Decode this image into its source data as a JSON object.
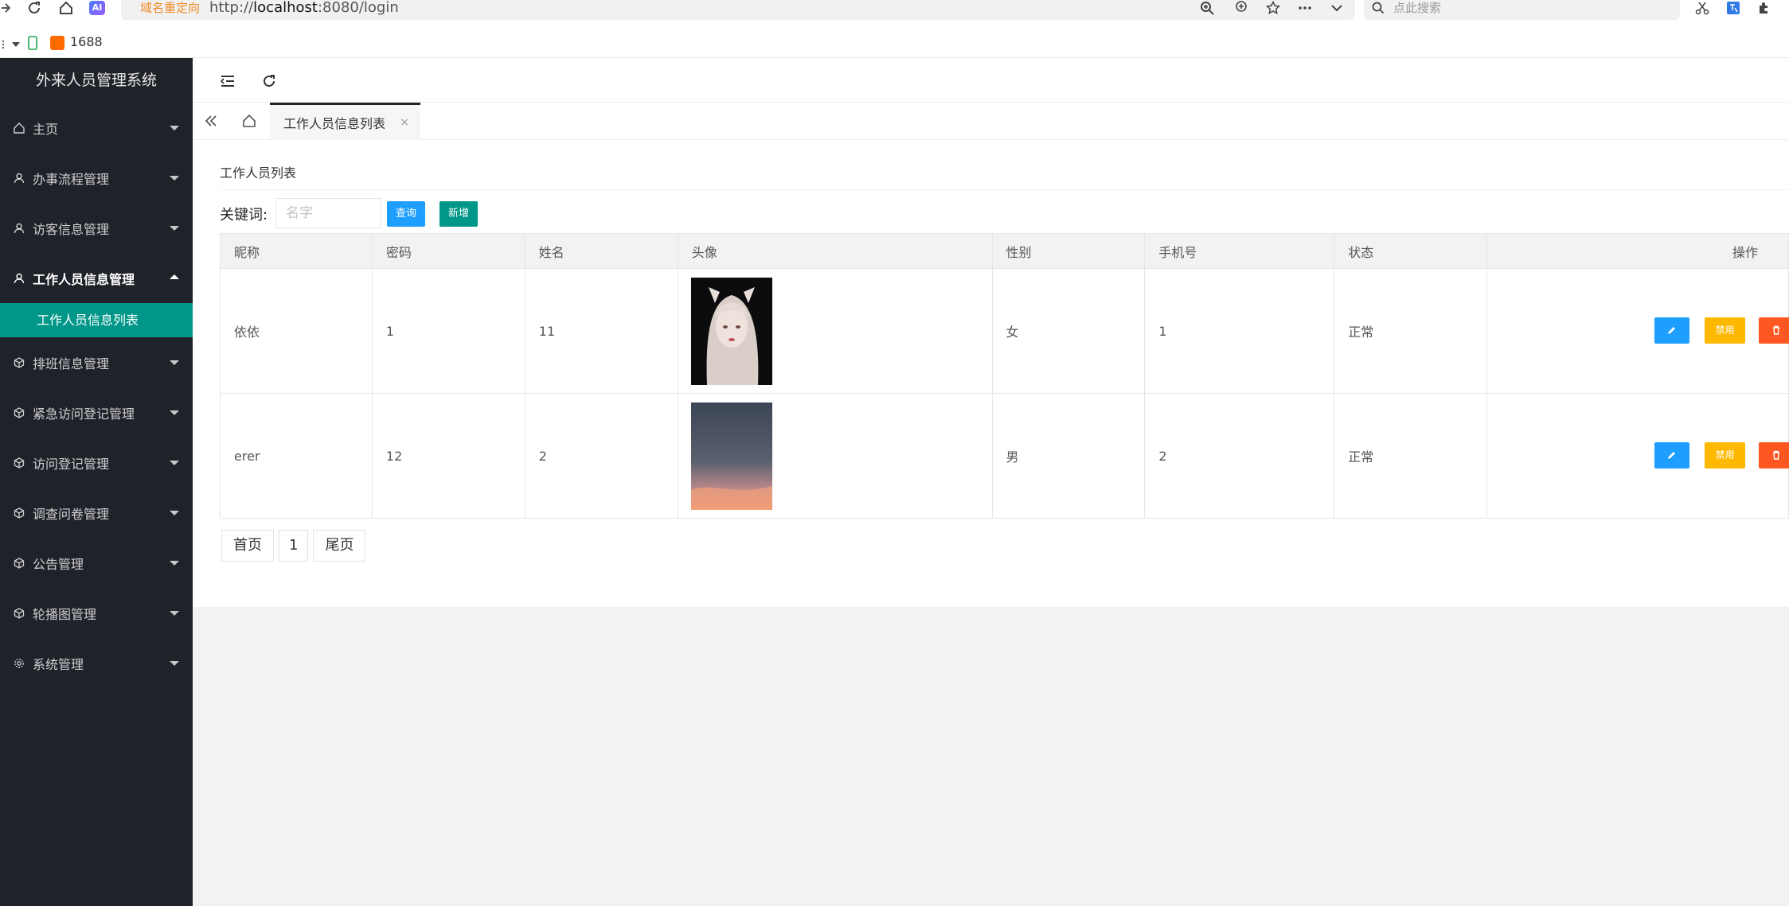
{
  "browser": {
    "redirect_label": "域名重定向",
    "url_prefix": "http://",
    "url_host": "localhost",
    "url_rest": ":8080/login",
    "search_placeholder": "点此搜索",
    "bookmarks": [
      {
        "label": "1688"
      }
    ],
    "ai_badge": "AI"
  },
  "sidebar": {
    "title": "外来人员管理系统",
    "items": [
      {
        "label": "主页",
        "icon": "home-icon"
      },
      {
        "label": "办事流程管理",
        "icon": "user-icon"
      },
      {
        "label": "访客信息管理",
        "icon": "user-icon"
      },
      {
        "label": "工作人员信息管理",
        "icon": "user-icon",
        "open": true
      },
      {
        "label": "排班信息管理",
        "icon": "cube-icon"
      },
      {
        "label": "紧急访问登记管理",
        "icon": "cube-icon"
      },
      {
        "label": "访问登记管理",
        "icon": "cube-icon"
      },
      {
        "label": "调查问卷管理",
        "icon": "cube-icon"
      },
      {
        "label": "公告管理",
        "icon": "cube-icon"
      },
      {
        "label": "轮播图管理",
        "icon": "cube-icon"
      },
      {
        "label": "系统管理",
        "icon": "gear-icon"
      }
    ],
    "sub_item": "工作人员信息列表"
  },
  "tabs": {
    "active": "工作人员信息列表",
    "close": "×"
  },
  "main": {
    "card_title": "工作人员列表",
    "keyword_label": "关键词:",
    "keyword_placeholder": "名字",
    "query_label": "查询",
    "add_label": "新增",
    "columns": [
      "昵称",
      "密码",
      "姓名",
      "头像",
      "性别",
      "手机号",
      "状态",
      "操作"
    ],
    "rows": [
      {
        "nickname": "依依",
        "password": "1",
        "name": "11",
        "gender": "女",
        "phone": "1",
        "status": "正常"
      },
      {
        "nickname": "erer",
        "password": "12",
        "name": "2",
        "gender": "男",
        "phone": "2",
        "status": "正常"
      }
    ],
    "disable_label": "禁用",
    "pager": {
      "first": "首页",
      "page": "1",
      "last": "尾页"
    }
  },
  "colors": {
    "sidebar_bg": "#20222a",
    "accent": "#009688",
    "blue": "#1e9fff",
    "warn": "#ffb800",
    "danger": "#ff5722"
  }
}
